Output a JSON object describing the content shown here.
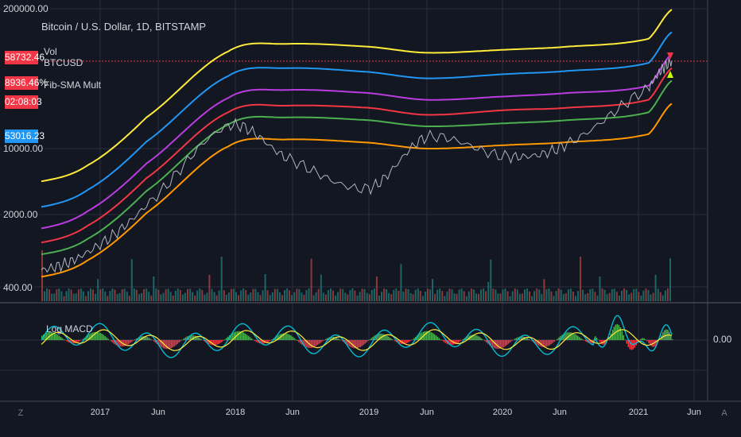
{
  "header": {
    "title": "Bitcoin / U.S. Dollar, 1D, BITSTAMP",
    "vol_label": "Vol",
    "symbol_label": "BTCUSD",
    "indicator_label": "Fib-SMA Mult",
    "macd_label": "Log MACD"
  },
  "price_axis": {
    "ticks": [
      "200000.00",
      "10000.00",
      "2000.00",
      "400.00"
    ],
    "macd_tick": "0.00"
  },
  "badges": {
    "last_price": "58732.46",
    "change_pct": "8936.46%",
    "countdown": "02:08:03",
    "second_price": "53016.23"
  },
  "time_axis": {
    "ticks": [
      "2017",
      "Jun",
      "2018",
      "Jun",
      "2019",
      "Jun",
      "2020",
      "Jun",
      "2021",
      "Jun"
    ]
  },
  "controls": {
    "left_circle": "Z",
    "right_circle": "A"
  },
  "colors": {
    "background": "#131722",
    "grid": "#2a2e39",
    "yellow": "#ffeb3b",
    "blue": "#2196f3",
    "purple": "#ba3ce0",
    "red": "#f23645",
    "green": "#4caf50",
    "orange": "#ff9800",
    "macd": "#00bcd4",
    "signal": "#ffeb3b",
    "price_candles": "#b2b5be",
    "badge_red": "#f23645",
    "badge_blue": "#2196f3"
  },
  "chart_data": {
    "type": "line",
    "title": "Bitcoin / U.S. Dollar, 1D, BITSTAMP",
    "y_scale": "log",
    "ylim": [
      300,
      200000
    ],
    "x": [
      "2016-09",
      "2017-01",
      "2017-06",
      "2018-01",
      "2018-06",
      "2019-01",
      "2019-06",
      "2020-01",
      "2020-06",
      "2021-01",
      "2021-03"
    ],
    "series": [
      {
        "name": "",
        "role": "price",
        "values": [
          600,
          900,
          2500,
          14000,
          7000,
          3600,
          11000,
          7200,
          9500,
          32000,
          58000
        ]
      },
      {
        "name": "",
        "role": "band-yellow",
        "values": [
          4200,
          6000,
          17000,
          72000,
          85000,
          80000,
          70000,
          75000,
          80000,
          95000,
          180000
        ]
      },
      {
        "name": "",
        "role": "band-blue",
        "values": [
          2400,
          3500,
          10000,
          42000,
          50000,
          46000,
          40000,
          44000,
          47000,
          56000,
          110000
        ]
      },
      {
        "name": "",
        "role": "band-purple",
        "values": [
          1500,
          2200,
          6200,
          26000,
          31000,
          29000,
          25000,
          27000,
          29000,
          34000,
          68000
        ]
      },
      {
        "name": "",
        "role": "band-red",
        "values": [
          1100,
          1600,
          4500,
          19000,
          22000,
          21000,
          18000,
          20000,
          21000,
          25000,
          50000
        ]
      },
      {
        "name": "",
        "role": "band-green",
        "values": [
          850,
          1200,
          3400,
          14500,
          17000,
          16000,
          14000,
          15000,
          16000,
          19000,
          38000
        ]
      },
      {
        "name": "",
        "role": "band-orange",
        "values": [
          520,
          750,
          2100,
          9000,
          10500,
          9800,
          8600,
          9300,
          9900,
          11800,
          23000
        ]
      }
    ],
    "macd_zero": 0.0,
    "grid": true,
    "legend": "top-left"
  }
}
